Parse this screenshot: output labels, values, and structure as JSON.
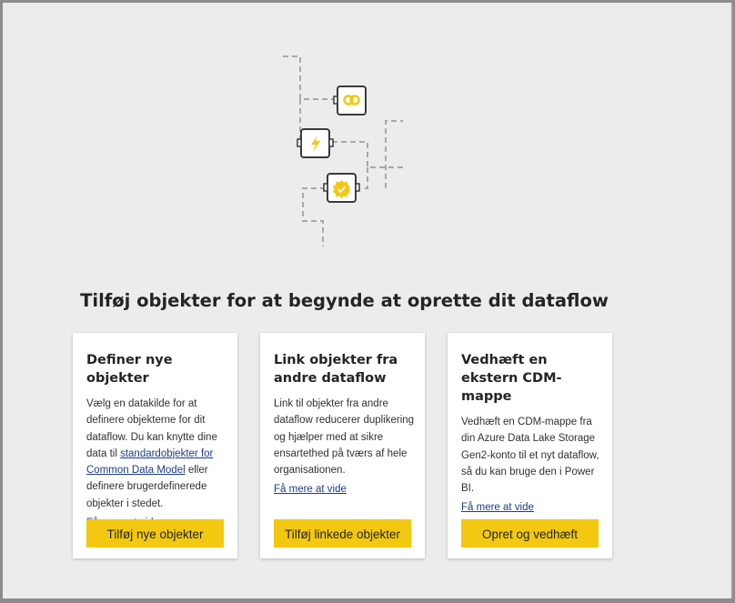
{
  "heading": "Tilføj objekter for at begynde at oprette dit dataflow",
  "illustration": {
    "icons": [
      "link-icon",
      "lightning-icon",
      "verified-badge-icon"
    ],
    "colors": {
      "accent": "#f2c811",
      "line": "#a8a8a8",
      "node_border": "#3b3a39"
    }
  },
  "cards": [
    {
      "title": "Definer nye objekter",
      "text_before_link": "Vælg en datakilde for at definere objekterne for dit dataflow. Du kan knytte dine data til ",
      "link": "standardobjekter for Common Data Model",
      "text_after_link": " eller definere brugerdefinerede objekter i stedet.",
      "learn_more": "Få mere at vide",
      "button": "Tilføj nye objekter"
    },
    {
      "title": "Link objekter fra andre dataflow",
      "text": "Link til objekter fra andre dataflow reducerer duplikering og hjælper med at sikre ensartethed på tværs af hele organisationen.",
      "learn_more": "Få mere at vide",
      "button": "Tilføj linkede objekter"
    },
    {
      "title": "Vedhæft en ekstern CDM-mappe",
      "text": "Vedhæft en CDM-mappe fra din Azure Data Lake Storage Gen2-konto til et nyt dataflow, så du kan bruge den i Power BI.",
      "learn_more": "Få mere at vide",
      "button": "Opret og vedhæft"
    }
  ]
}
